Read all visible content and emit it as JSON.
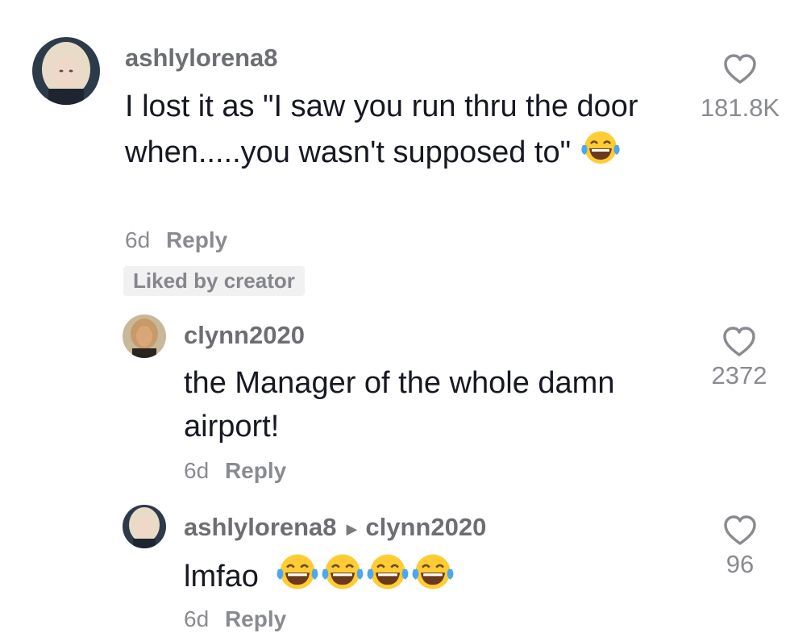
{
  "comments": [
    {
      "username": "ashlylorena8",
      "text": "I lost it as \"I saw you run thru the door when.....you wasn't supposed to\"",
      "emoji": "face-with-tears-of-joy",
      "date": "6d",
      "reply_label": "Reply",
      "badge": "Liked by creator",
      "likes": "181.8K",
      "avatar": "woman-blonde-avatar"
    },
    {
      "username": "clynn2020",
      "text": "the Manager of the whole damn airport!",
      "date": "6d",
      "reply_label": "Reply",
      "likes": "2372",
      "avatar": "woman-tan-avatar"
    },
    {
      "username": "ashlylorena8",
      "reply_to": "clynn2020",
      "text": "lmfao",
      "emoji": "face-with-tears-of-joy",
      "emoji_count": 4,
      "date": "6d",
      "reply_label": "Reply",
      "likes": "96",
      "avatar": "woman-blonde-avatar"
    }
  ],
  "icons": {
    "like": "heart-outline-icon",
    "reply_arrow": "caret-right-icon"
  },
  "colors": {
    "username": "#6c6e73",
    "text": "#161823",
    "meta": "#8a8b91",
    "badge_bg": "#f1f1f2",
    "emoji_face": "#ffcc33",
    "emoji_tear": "#4aa8f0"
  }
}
